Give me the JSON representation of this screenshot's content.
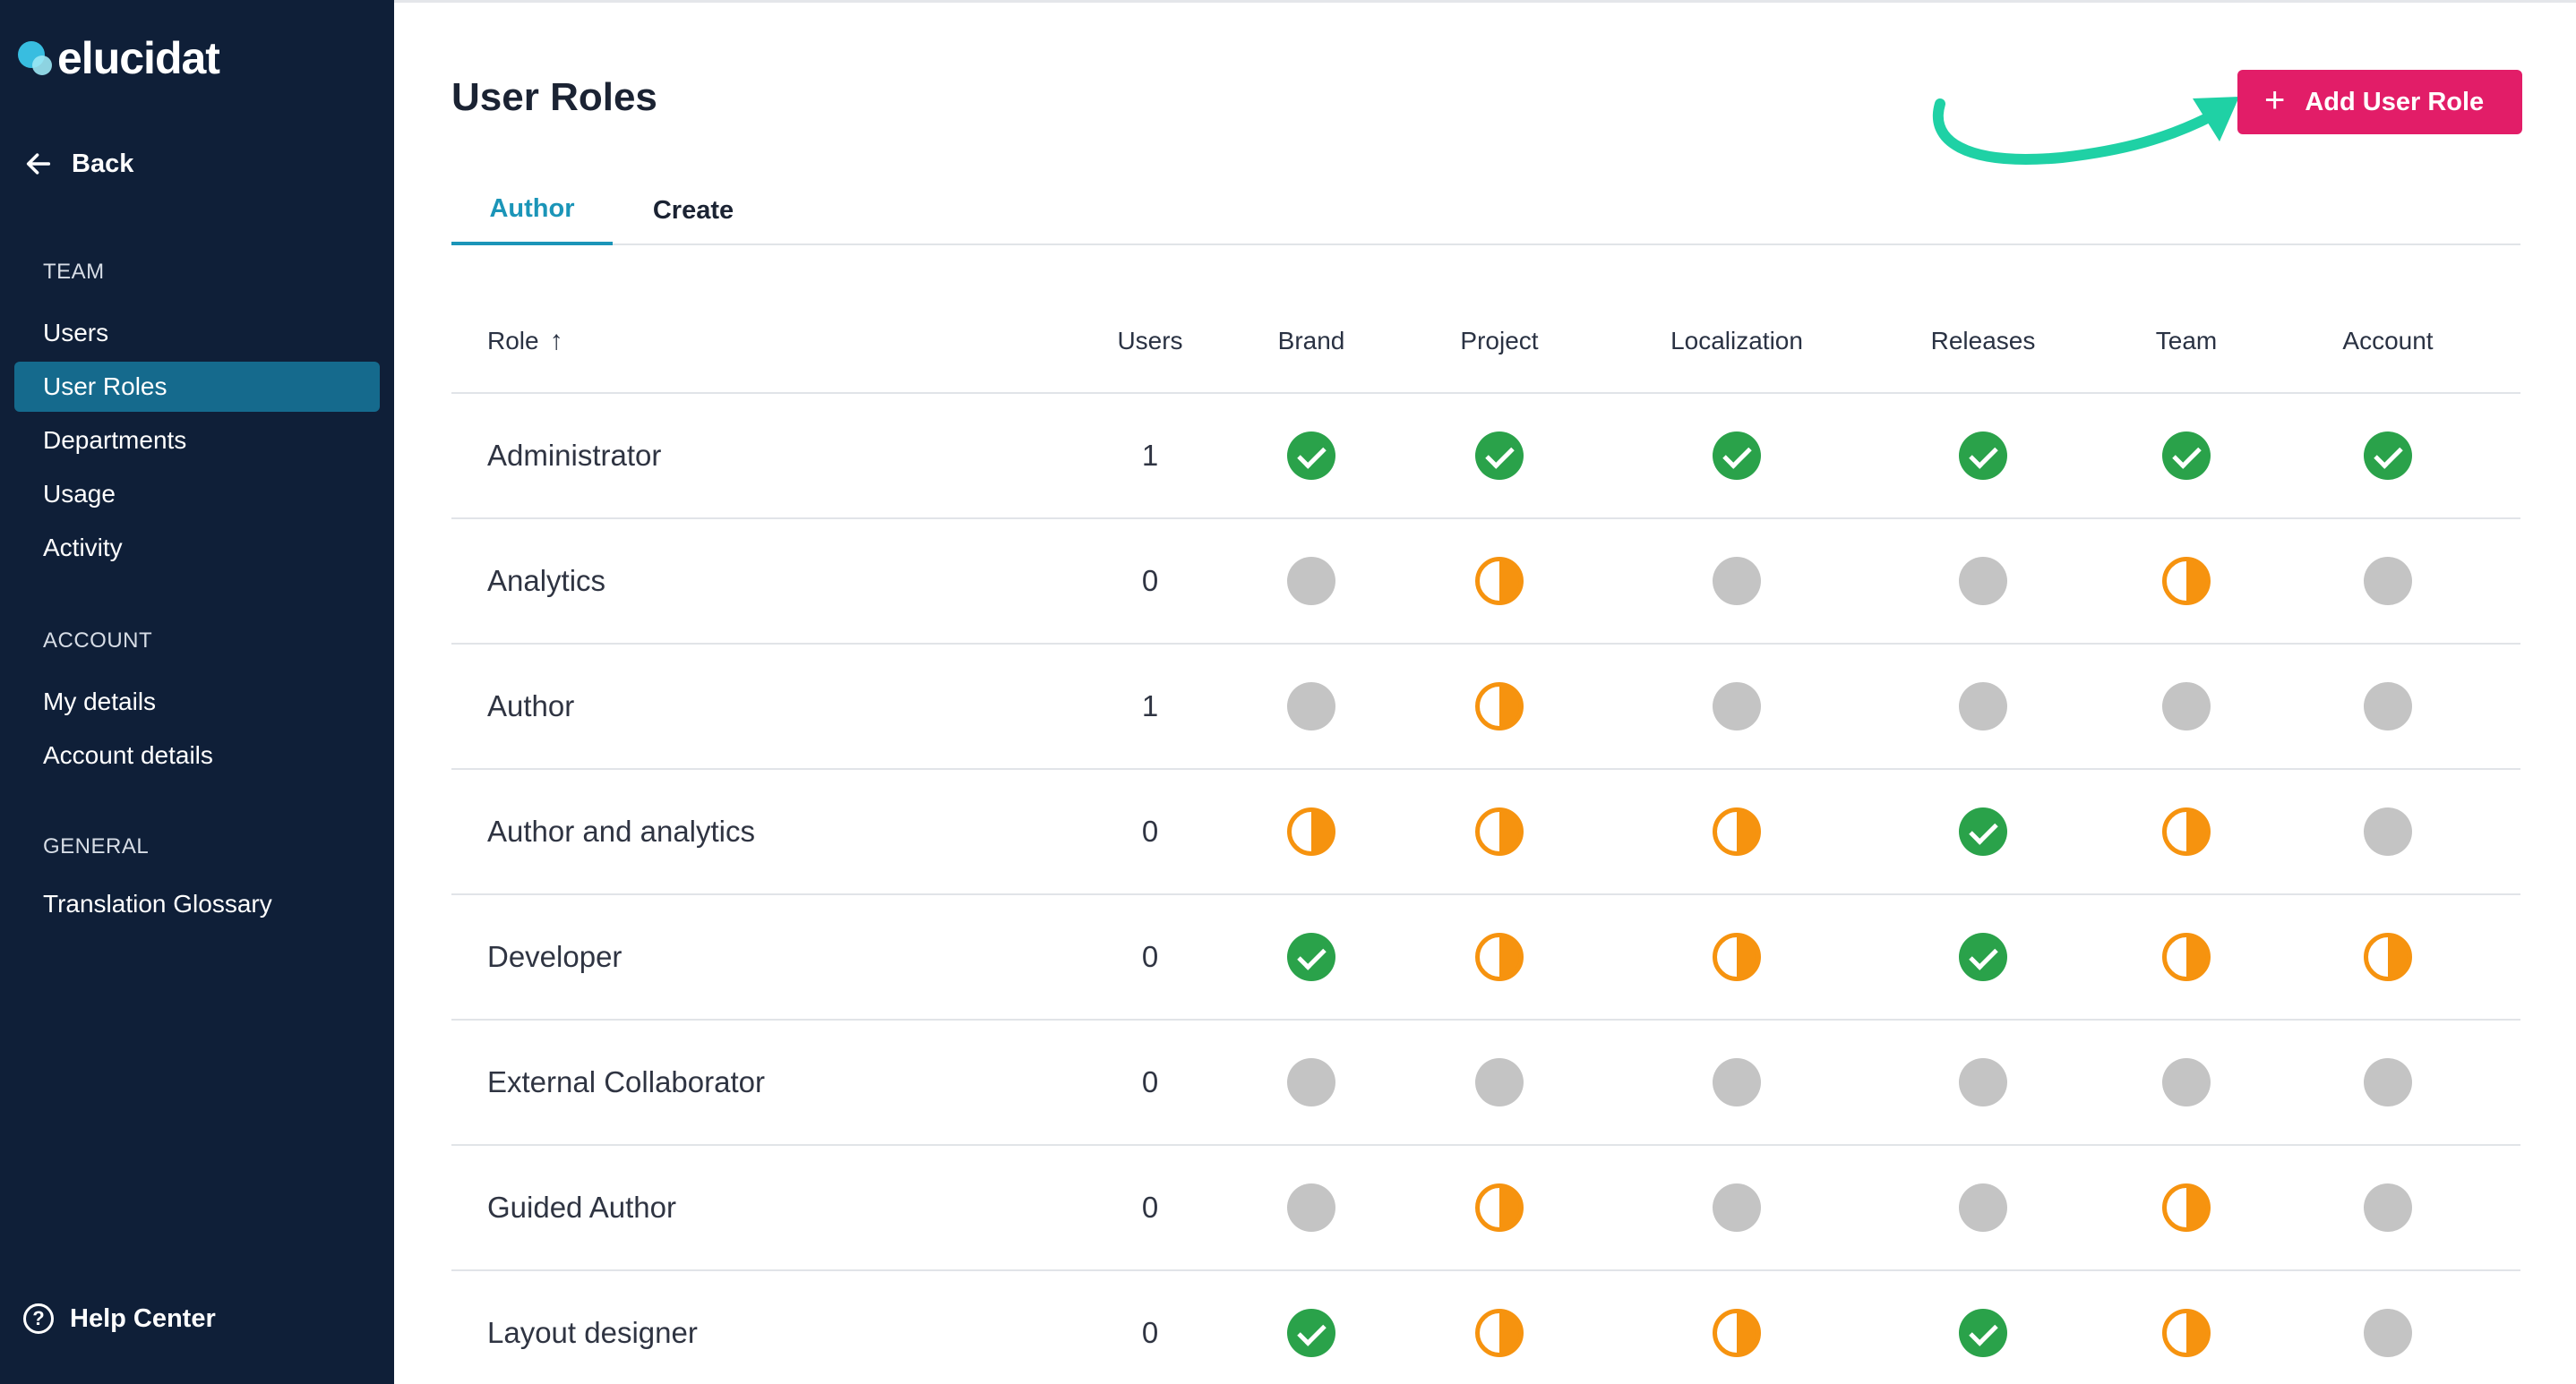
{
  "app": {
    "logo_text": "elucidat"
  },
  "sidebar": {
    "back_label": "Back",
    "sections": [
      {
        "label": "TEAM",
        "items": [
          {
            "label": "Users",
            "active": false
          },
          {
            "label": "User Roles",
            "active": true
          },
          {
            "label": "Departments",
            "active": false
          },
          {
            "label": "Usage",
            "active": false
          },
          {
            "label": "Activity",
            "active": false
          }
        ]
      },
      {
        "label": "ACCOUNT",
        "items": [
          {
            "label": "My details",
            "active": false
          },
          {
            "label": "Account details",
            "active": false
          }
        ]
      },
      {
        "label": "GENERAL",
        "items": [
          {
            "label": "Translation Glossary",
            "active": false
          }
        ]
      }
    ],
    "help_label": "Help Center"
  },
  "main": {
    "title": "User Roles",
    "add_button_label": "Add User Role",
    "tabs": [
      {
        "label": "Author",
        "active": true
      },
      {
        "label": "Create",
        "active": false
      }
    ],
    "columns": [
      "Role",
      "Users",
      "Brand",
      "Project",
      "Localization",
      "Releases",
      "Team",
      "Account"
    ],
    "sort_icon": "arrow-up-icon",
    "rows": [
      {
        "role": "Administrator",
        "users": "1",
        "perms": [
          "full",
          "full",
          "full",
          "full",
          "full",
          "full"
        ]
      },
      {
        "role": "Analytics",
        "users": "0",
        "perms": [
          "none",
          "partial",
          "none",
          "none",
          "partial",
          "none"
        ]
      },
      {
        "role": "Author",
        "users": "1",
        "perms": [
          "none",
          "partial",
          "none",
          "none",
          "none",
          "none"
        ]
      },
      {
        "role": "Author and analytics",
        "users": "0",
        "perms": [
          "partial",
          "partial",
          "partial",
          "full",
          "partial",
          "none"
        ]
      },
      {
        "role": "Developer",
        "users": "0",
        "perms": [
          "full",
          "partial",
          "partial",
          "full",
          "partial",
          "partial"
        ]
      },
      {
        "role": "External Collaborator",
        "users": "0",
        "perms": [
          "none",
          "none",
          "none",
          "none",
          "none",
          "none"
        ]
      },
      {
        "role": "Guided Author",
        "users": "0",
        "perms": [
          "none",
          "partial",
          "none",
          "none",
          "partial",
          "none"
        ]
      },
      {
        "role": "Layout designer",
        "users": "0",
        "perms": [
          "full",
          "partial",
          "partial",
          "full",
          "partial",
          "none"
        ]
      }
    ]
  },
  "colors": {
    "sidebar_bg": "#0f1f38",
    "active_nav": "#156a8d",
    "accent_button": "#e21d68",
    "tab_active": "#1b95b8",
    "full": "#2aa24a",
    "partial": "#f6930f",
    "none": "#c4c4c4",
    "annotation_arrow": "#1fd1a5"
  }
}
